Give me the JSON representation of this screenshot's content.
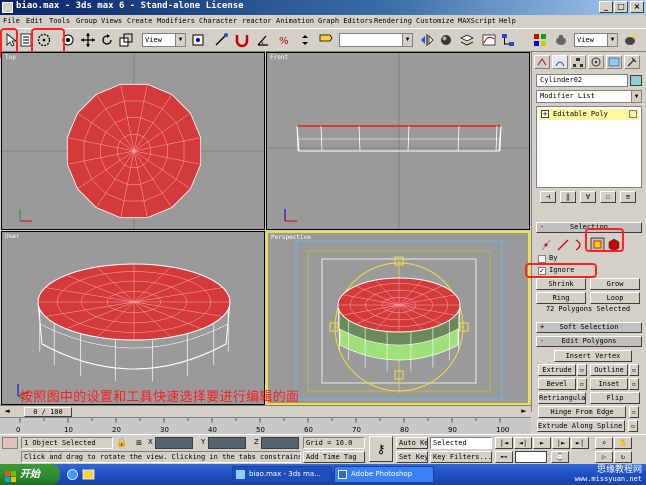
{
  "window": {
    "title": "biao.max - 3ds max 6 - Stand-alone License",
    "minimize": "_",
    "maximize": "□",
    "close": "×"
  },
  "menu": [
    "File",
    "Edit",
    "Tools",
    "Group",
    "Views",
    "Create",
    "Modifiers",
    "Character",
    "reactor",
    "Animation",
    "Graph Editors",
    "Rendering",
    "Customize",
    "MAXScript",
    "Help"
  ],
  "toolbar": {
    "view_dropdown": "View",
    "view_dropdown_right": "View",
    "selection_set": ""
  },
  "viewports": {
    "top": "Top",
    "front": "Front",
    "user": "User",
    "perspective": "Perspective"
  },
  "command_panel": {
    "object_name": "Cylinder02",
    "modifier_list": "Modifier List",
    "stack_item": "Editable Poly",
    "selection_rollout": "Selection",
    "by_label": "By",
    "ignore_label": "Ignore",
    "shrink": "Shrink",
    "grow": "Grow",
    "ring": "Ring",
    "loop": "Loop",
    "selected_info": "72 Polygons Selected",
    "soft_selection": "Soft Selection",
    "edit_polygons": "Edit Polygons",
    "insert_vertex": "Insert Vertex",
    "extrude": "Extrude",
    "outline": "Outline",
    "bevel": "Bevel",
    "inset": "Inset",
    "retriangulate": "Retriangulate",
    "flip": "Flip",
    "hinge_from_edge": "Hinge From Edge",
    "extrude_along_spline": "Extrude Along Spline",
    "rollout_sign": "+",
    "rollout_sign_open": "-"
  },
  "caption": "按照图中的设置和工具快速选择要进行编辑的面",
  "timeline": {
    "frame": "0 / 100",
    "ticks": [
      "0",
      "10",
      "20",
      "30",
      "40",
      "50",
      "60",
      "70",
      "80",
      "90",
      "100"
    ]
  },
  "status": {
    "objects_selected": "1 Object Selected",
    "prompt": "Click and drag to rotate the view.  Clicking in the tabs constrains",
    "x_label": "X",
    "y_label": "Y",
    "z_label": "Z",
    "grid": "Grid = 10.0",
    "add_time_tag": "Add Time Tag",
    "auto_key": "Auto Key",
    "set_key": "Set Key",
    "key_mode": "Selected",
    "key_filters": "Key Filters..."
  },
  "taskbar": {
    "start": "开始",
    "tasks": [
      "biao.max - 3ds ma...",
      "Adobe Photoshop"
    ]
  },
  "watermark": {
    "name": "思缘教程网",
    "url": "www.missyuan.net"
  },
  "colors": {
    "selected_face": "#d43a3a",
    "wire": "#ffffff",
    "highlight_box": "#ff2020",
    "active_viewport": "#f0e040"
  }
}
